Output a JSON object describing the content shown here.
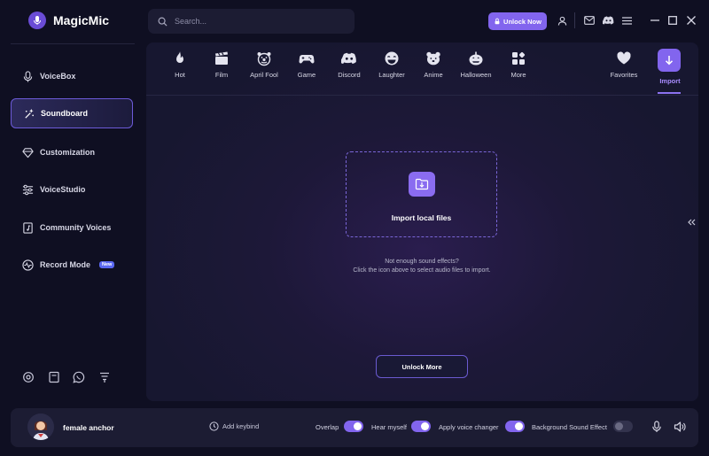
{
  "app": {
    "name": "MagicMic"
  },
  "search": {
    "placeholder": "Search..."
  },
  "header": {
    "unlock_label": "Unlock Now"
  },
  "sidebar": {
    "items": [
      {
        "label": "VoiceBox",
        "icon": "microphone-icon"
      },
      {
        "label": "Soundboard",
        "icon": "sparkle-wand-icon",
        "active": true
      },
      {
        "label": "Customization",
        "icon": "diamond-icon"
      },
      {
        "label": "VoiceStudio",
        "icon": "sliders-icon"
      },
      {
        "label": "Community Voices",
        "icon": "music-file-icon"
      },
      {
        "label": "Record Mode",
        "icon": "waveform-icon",
        "badge": "New"
      }
    ]
  },
  "categories": [
    {
      "label": "Hot",
      "icon": "flame-icon"
    },
    {
      "label": "Film",
      "icon": "clapperboard-icon"
    },
    {
      "label": "April Fool",
      "icon": "clown-icon"
    },
    {
      "label": "Game",
      "icon": "gamepad-icon"
    },
    {
      "label": "Discord",
      "icon": "discord-icon"
    },
    {
      "label": "Laughter",
      "icon": "laughing-face-icon"
    },
    {
      "label": "Anime",
      "icon": "bear-face-icon"
    },
    {
      "label": "Halloween",
      "icon": "pumpkin-icon"
    },
    {
      "label": "More",
      "icon": "grid-icon"
    },
    {
      "label": "Favorites",
      "icon": "heart-icon"
    },
    {
      "label": "Import",
      "icon": "download-arrow-icon",
      "active": true
    }
  ],
  "import": {
    "box_label": "Import local files",
    "hint_line1": "Not enough sound effects?",
    "hint_line2": "Click the icon above to select audio files to import.",
    "unlock_more_label": "Unlock More"
  },
  "bottom": {
    "voice_name": "female anchor",
    "keybind_label": "Add keybind",
    "toggles": [
      {
        "label": "Overlap",
        "on": true
      },
      {
        "label": "Hear myself",
        "on": true
      },
      {
        "label": "Apply voice changer",
        "on": true
      },
      {
        "label": "Background Sound Effect",
        "on": false
      }
    ]
  },
  "colors": {
    "accent": "#8265ee",
    "background": "#0f0f22",
    "panel": "#1c1c33"
  }
}
